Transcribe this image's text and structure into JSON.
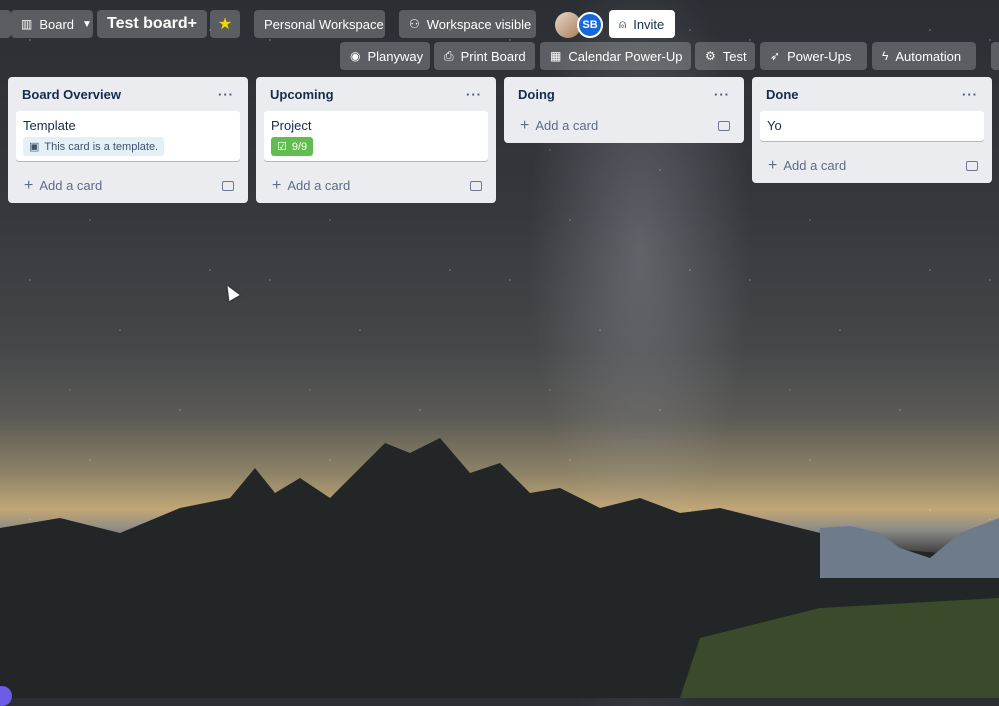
{
  "header": {
    "board_view_label": "Board",
    "board_title": "Test board+",
    "workspace": "Personal Workspace",
    "visibility": "Workspace visible",
    "member_initials": "SB",
    "invite_label": "Invite"
  },
  "powerups_bar": {
    "items": [
      {
        "label": "Planyway",
        "icon": "planyway-icon"
      },
      {
        "label": "Print Board",
        "icon": "printer-icon"
      },
      {
        "label": "Calendar Power-Up",
        "icon": "calendar-icon"
      },
      {
        "label": "Test",
        "icon": "gears-icon"
      },
      {
        "label": "Power-Ups",
        "icon": "rocket-icon"
      },
      {
        "label": "Automation",
        "icon": "bolt-icon"
      }
    ]
  },
  "lists": [
    {
      "title": "Board Overview",
      "cards": [
        {
          "title": "Template",
          "badge": "This card is a template."
        }
      ],
      "add_label": "Add a card"
    },
    {
      "title": "Upcoming",
      "cards": [
        {
          "title": "Project",
          "badge": "9/9"
        }
      ],
      "add_label": "Add a card"
    },
    {
      "title": "Doing",
      "cards": [],
      "add_label": "Add a card"
    },
    {
      "title": "Done",
      "cards": [
        {
          "title": "Yo"
        }
      ],
      "add_label": "Add a card"
    }
  ],
  "colors": {
    "star": "#f2d600",
    "checklist_badge": "#61bd4f",
    "list_bg": "#ebecf0",
    "avatar_sb": "#1468d8"
  }
}
